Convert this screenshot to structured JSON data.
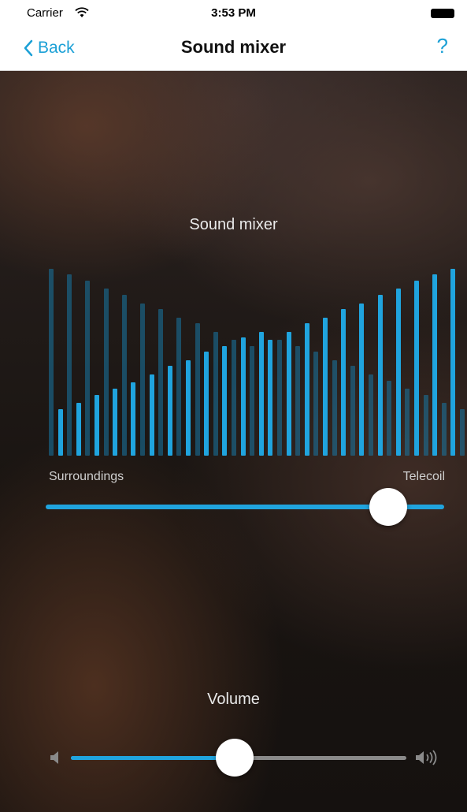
{
  "status": {
    "carrier": "Carrier",
    "time": "3:53 PM"
  },
  "nav": {
    "back_label": "Back",
    "title": "Sound mixer",
    "help_label": "?"
  },
  "mixer": {
    "title": "Sound mixer",
    "left_label": "Surroundings",
    "right_label": "Telecoil",
    "balance": 0.86,
    "pairs_left": [
      [
        0.92,
        0.23
      ],
      [
        0.89,
        0.26
      ],
      [
        0.86,
        0.3
      ],
      [
        0.82,
        0.33
      ],
      [
        0.79,
        0.36
      ],
      [
        0.75,
        0.4
      ],
      [
        0.72,
        0.44
      ],
      [
        0.68,
        0.47
      ],
      [
        0.65,
        0.51
      ],
      [
        0.61,
        0.54
      ],
      [
        0.57,
        0.58
      ],
      [
        0.54,
        0.61
      ]
    ],
    "pairs_right": [
      [
        0.61,
        0.54
      ],
      [
        0.65,
        0.51
      ],
      [
        0.68,
        0.47
      ],
      [
        0.72,
        0.44
      ],
      [
        0.75,
        0.4
      ],
      [
        0.79,
        0.37
      ],
      [
        0.82,
        0.33
      ],
      [
        0.86,
        0.3
      ],
      [
        0.89,
        0.26
      ],
      [
        0.92,
        0.23
      ]
    ],
    "center_pair": [
      0.57,
      0.57
    ]
  },
  "volume": {
    "title": "Volume",
    "level": 0.5
  },
  "colors": {
    "accent": "#20a4de",
    "accent_dim": "#1878a6",
    "background": "#15110f"
  }
}
